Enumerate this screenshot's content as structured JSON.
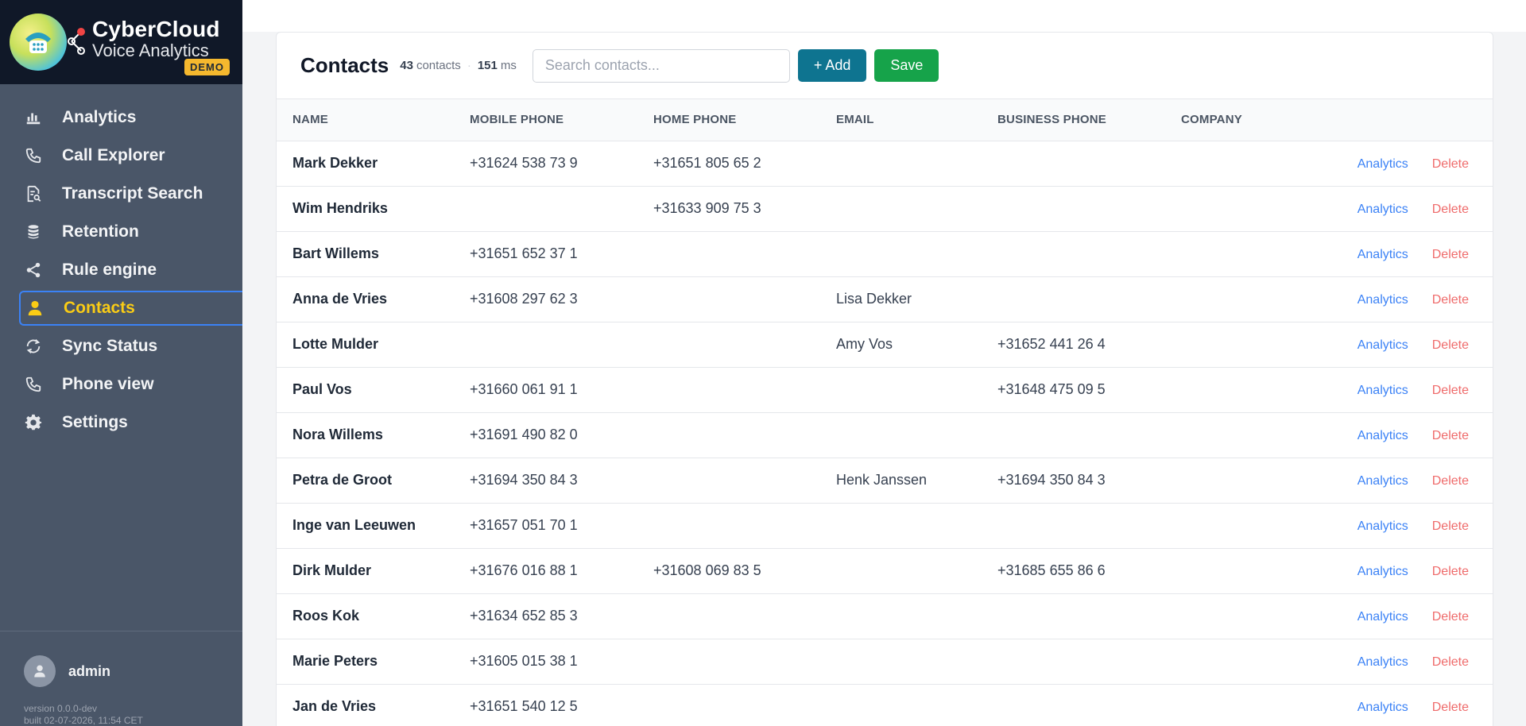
{
  "brand": {
    "title": "CyberCloud",
    "subtitle": "Voice Analytics",
    "badge": "DEMO"
  },
  "sidebar": {
    "items": [
      {
        "label": "Analytics",
        "icon": "bar-chart-icon"
      },
      {
        "label": "Call Explorer",
        "icon": "phone-icon"
      },
      {
        "label": "Transcript Search",
        "icon": "document-search-icon"
      },
      {
        "label": "Retention",
        "icon": "database-icon"
      },
      {
        "label": "Rule engine",
        "icon": "share-icon"
      },
      {
        "label": "Contacts",
        "icon": "user-icon",
        "active": true
      },
      {
        "label": "Sync Status",
        "icon": "sync-icon"
      },
      {
        "label": "Phone view",
        "icon": "phone-icon"
      },
      {
        "label": "Settings",
        "icon": "gear-icon"
      }
    ],
    "user": "admin",
    "version": "version 0.0.0-dev",
    "built": "built 02-07-2026, 11:54 CET"
  },
  "header": {
    "title": "Contacts",
    "count": "43",
    "count_unit": "contacts",
    "timing": "151",
    "timing_unit": "ms",
    "search_placeholder": "Search contacts...",
    "add_label": "+ Add",
    "save_label": "Save"
  },
  "table": {
    "columns": [
      "Name",
      "Mobile Phone",
      "Home Phone",
      "Email",
      "Business Phone",
      "Company"
    ],
    "action_analytics": "Analytics",
    "action_delete": "Delete",
    "rows": [
      {
        "name": "Mark Dekker",
        "mobile": "+31624 538 73 9",
        "home": "+31651 805 65 2",
        "email": "",
        "business": "",
        "company": ""
      },
      {
        "name": "Wim Hendriks",
        "mobile": "",
        "home": "+31633 909 75 3",
        "email": "",
        "business": "",
        "company": ""
      },
      {
        "name": "Bart Willems",
        "mobile": "+31651 652 37 1",
        "home": "",
        "email": "",
        "business": "",
        "company": ""
      },
      {
        "name": "Anna de Vries",
        "mobile": "+31608 297 62 3",
        "home": "",
        "email": "Lisa Dekker",
        "business": "",
        "company": ""
      },
      {
        "name": "Lotte Mulder",
        "mobile": "",
        "home": "",
        "email": "Amy Vos",
        "business": "+31652 441 26 4",
        "company": ""
      },
      {
        "name": "Paul Vos",
        "mobile": "+31660 061 91 1",
        "home": "",
        "email": "",
        "business": "+31648 475 09 5",
        "company": ""
      },
      {
        "name": "Nora Willems",
        "mobile": "+31691 490 82 0",
        "home": "",
        "email": "",
        "business": "",
        "company": ""
      },
      {
        "name": "Petra de Groot",
        "mobile": "+31694 350 84 3",
        "home": "",
        "email": "Henk Janssen",
        "business": "+31694 350 84 3",
        "company": ""
      },
      {
        "name": "Inge van Leeuwen",
        "mobile": "+31657 051 70 1",
        "home": "",
        "email": "",
        "business": "",
        "company": ""
      },
      {
        "name": "Dirk Mulder",
        "mobile": "+31676 016 88 1",
        "home": "+31608 069 83 5",
        "email": "",
        "business": "+31685 655 86 6",
        "company": ""
      },
      {
        "name": "Roos Kok",
        "mobile": "+31634 652 85 3",
        "home": "",
        "email": "",
        "business": "",
        "company": ""
      },
      {
        "name": "Marie Peters",
        "mobile": "+31605 015 38 1",
        "home": "",
        "email": "",
        "business": "",
        "company": ""
      },
      {
        "name": "Jan de Vries",
        "mobile": "+31651 540 12 5",
        "home": "",
        "email": "",
        "business": "",
        "company": ""
      }
    ]
  }
}
